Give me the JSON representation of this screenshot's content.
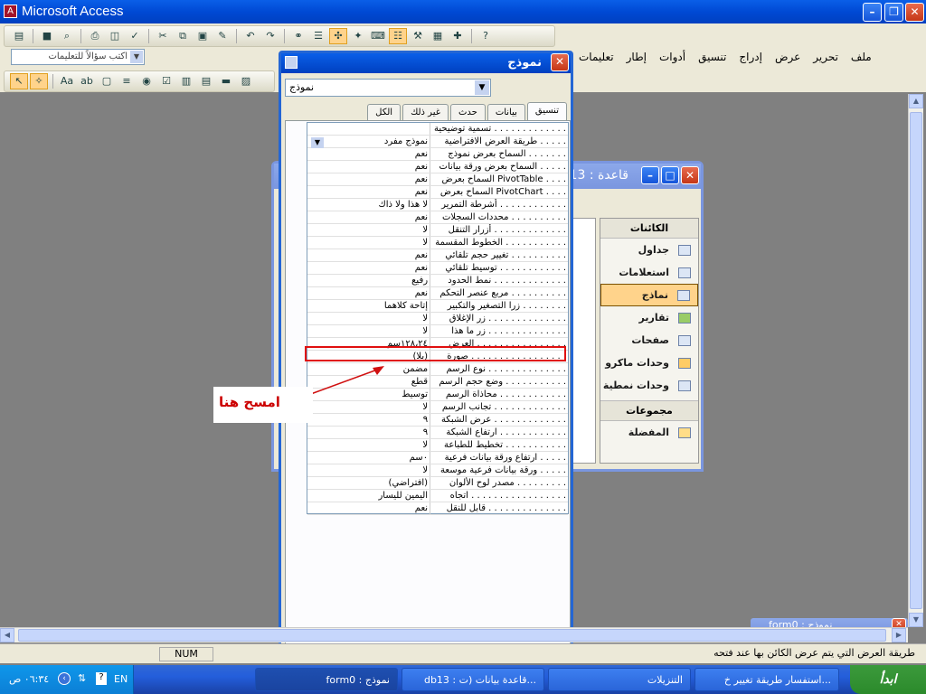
{
  "app": {
    "title": "Microsoft Access",
    "icon": "access-icon"
  },
  "menu": [
    "ملف",
    "تحرير",
    "عرض",
    "إدراج",
    "تنسيق",
    "أدوات",
    "إطار",
    "تعليمات"
  ],
  "ask_box": {
    "placeholder": "اكتب سؤالاً للتعليمات"
  },
  "db_window": {
    "title": "db13 : قاعدة"
  },
  "objects": {
    "header": "الكائنات",
    "items": [
      {
        "label": "جداول",
        "icon": "table-icon"
      },
      {
        "label": "استعلامات",
        "icon": "query-icon"
      },
      {
        "label": "نماذج",
        "icon": "form-icon",
        "selected": true
      },
      {
        "label": "تقارير",
        "icon": "report-icon"
      },
      {
        "label": "صفحات",
        "icon": "page-icon"
      },
      {
        "label": "وحدات ماكرو",
        "icon": "macro-icon"
      },
      {
        "label": "وحدات نمطية",
        "icon": "module-icon"
      }
    ],
    "groups_header": "مجموعات",
    "groups": [
      {
        "label": "المفضلة",
        "icon": "favorites-icon"
      }
    ]
  },
  "property_sheet": {
    "title": "نموذج",
    "object_select": "نموذج",
    "tabs": [
      "تنسيق",
      "بيانات",
      "حدث",
      "غير ذلك",
      "الكل"
    ],
    "rows": [
      {
        "name": "تسمية توضيحية . . . . . . . . . . . . .",
        "value": ""
      },
      {
        "name": "طريقة العرض الافتراضية . . . . .",
        "value": "نموذج مفرد"
      },
      {
        "name": "السماح بعرض نموذج . . . . . . .",
        "value": "نعم"
      },
      {
        "name": "السماح بعرض ورقة بيانات . . . . .",
        "value": "نعم"
      },
      {
        "name": "السماح بعرض PivotTable . . . .",
        "value": "نعم"
      },
      {
        "name": "السماح بعرض PivotChart . . . .",
        "value": "نعم"
      },
      {
        "name": "أشرطة التمرير . . . . . . . . . . . .",
        "value": "لا هذا ولا ذاك"
      },
      {
        "name": "محددات السجلات . . . . . . . . . .",
        "value": "نعم"
      },
      {
        "name": "أزرار التنقل . . . . . . . . . . . . .",
        "value": "لا"
      },
      {
        "name": "الخطوط المقسمة . . . . . . . . . . .",
        "value": "لا"
      },
      {
        "name": "تغيير حجم تلقائي . . . . . . . . . .",
        "value": "نعم"
      },
      {
        "name": "توسيط تلقائي . . . . . . . . . . . .",
        "value": "نعم"
      },
      {
        "name": "نمط الحدود . . . . . . . . . . . . .",
        "value": "رفيع"
      },
      {
        "name": "مربع عنصر التحكم . . . . . . . . . .",
        "value": "نعم"
      },
      {
        "name": "زرا التصغير والتكبير . . . . . . . .",
        "value": "إتاحة كلاهما"
      },
      {
        "name": "زر الإغلاق . . . . . . . . . . . . . .",
        "value": "لا"
      },
      {
        "name": "زر ما هذا . . . . . . . . . . . . . .",
        "value": "لا"
      },
      {
        "name": "العرض . . . . . . . . . . . . . . . .",
        "value": "١٢٨،٢٤سم"
      },
      {
        "name": "صورة . . . . . . . . . . . . . . . . .",
        "value": "(بلا)"
      },
      {
        "name": "نوع الرسم . . . . . . . . . . . . . .",
        "value": "مضمن"
      },
      {
        "name": "وضع حجم الرسم . . . . . . . . . . .",
        "value": "قطع"
      },
      {
        "name": "محاذاة الرسم . . . . . . . . . . . .",
        "value": "توسيط"
      },
      {
        "name": "تجانب الرسم . . . . . . . . . . . . .",
        "value": "لا"
      },
      {
        "name": "عرض الشبكة . . . . . . . . . . . . .",
        "value": "٩"
      },
      {
        "name": "ارتفاع الشبكة . . . . . . . . . . . .",
        "value": "٩"
      },
      {
        "name": "تخطيط للطباعة . . . . . . . . . . .",
        "value": "لا"
      },
      {
        "name": "ارتفاع ورقة بيانات فرعية . . . . .",
        "value": "٠سم"
      },
      {
        "name": "ورقة بيانات فرعية موسعة . . . . .",
        "value": "لا"
      },
      {
        "name": "مصدر لوح الألوان . . . . . . . . .",
        "value": "(افتراضي)"
      },
      {
        "name": "اتجاه . . . . . . . . . . . . . . . . .",
        "value": "اليمين لليسار"
      },
      {
        "name": "قابل للنقل . . . . . . . . . . . . . .",
        "value": "نعم"
      }
    ]
  },
  "annotation": {
    "text": "امسح هنا",
    "color": "#cc0000"
  },
  "minimized_form": {
    "title": "form0 : نموذج"
  },
  "status": {
    "text": "طريقة العرض التي يتم عرض الكائن بها عند فتحه",
    "num": "NUM"
  },
  "taskbar": {
    "start": "ابدأ",
    "tasks": [
      {
        "label": "استفسار طريقة تغيير خ...",
        "icon": "firefox-icon"
      },
      {
        "label": "التنزيلات",
        "icon": "folder-icon"
      },
      {
        "label": "db13 : قاعدة بيانات (ت...",
        "icon": "access-icon"
      },
      {
        "label": "form0 : نموذج",
        "icon": "form-icon"
      }
    ],
    "lang": "EN",
    "clock": "٠٦:٣٤ ص"
  }
}
